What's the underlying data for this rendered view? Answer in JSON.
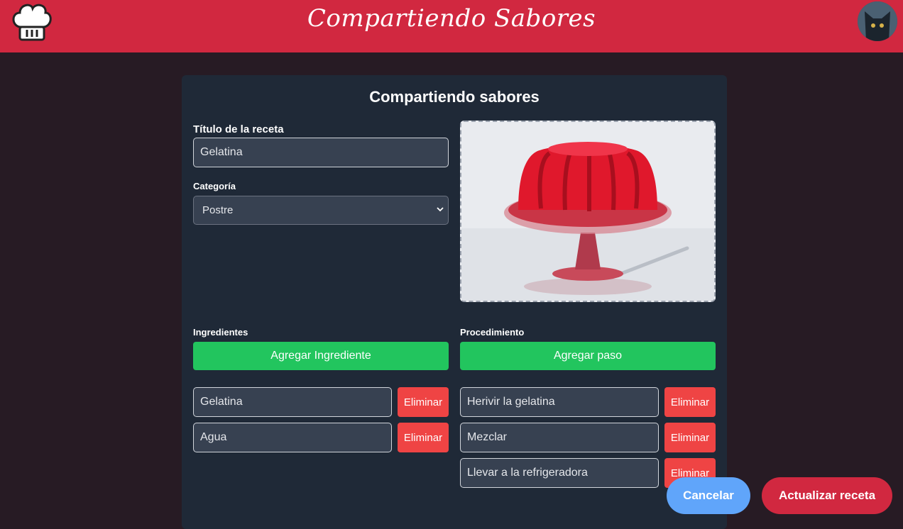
{
  "header": {
    "brand": "Compartiendo Sabores",
    "logo_icon": "chef-hat-icon",
    "avatar_icon": "cat-avatar"
  },
  "form": {
    "heading": "Compartiendo sabores",
    "title_label": "Título de la receta",
    "title_value": "Gelatina",
    "category_label": "Categoría",
    "category_value": "Postre",
    "image_icon": "gelatin-dessert-photo"
  },
  "ingredients": {
    "label": "Ingredientes",
    "add_label": "Agregar Ingrediente",
    "items": [
      {
        "value": "Gelatina",
        "remove_label": "Eliminar"
      },
      {
        "value": "Agua",
        "remove_label": "Eliminar"
      }
    ]
  },
  "procedure": {
    "label": "Procedimiento",
    "add_label": "Agregar paso",
    "steps": [
      {
        "value": "Herivir la gelatina",
        "remove_label": "Eliminar"
      },
      {
        "value": "Mezclar",
        "remove_label": "Eliminar"
      },
      {
        "value": "Llevar a la refrigeradora",
        "remove_label": "Eliminar"
      }
    ]
  },
  "actions": {
    "cancel_label": "Cancelar",
    "update_label": "Actualizar receta"
  },
  "colors": {
    "brand": "#d12840",
    "background": "#271b24",
    "card": "#1f2937",
    "input": "#374151",
    "green": "#22c55e",
    "red": "#ef4444",
    "cancel": "#60a5fa"
  }
}
